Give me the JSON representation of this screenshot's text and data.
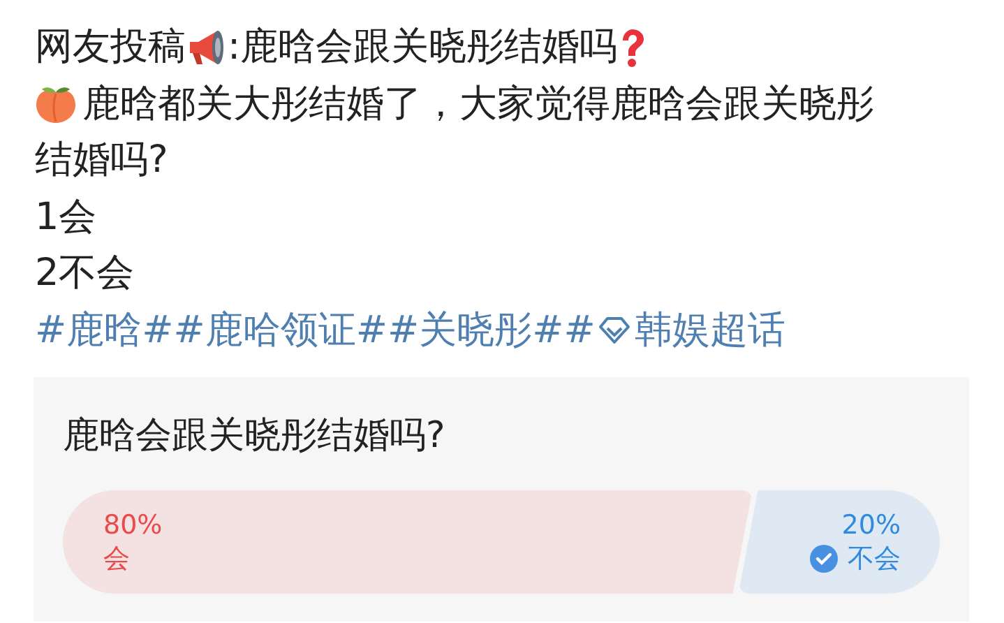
{
  "post": {
    "title": {
      "before": "网友投稿",
      "after": ":鹿晗会跟关晓彤结婚吗"
    },
    "body_lines": [
      "鹿晗都关大彤结婚了，大家觉得鹿晗会跟关晓彤",
      "结婚吗?"
    ],
    "choices": [
      "1会",
      "2不会"
    ],
    "hashtags": [
      {
        "kind": "topic",
        "text": "#鹿晗#"
      },
      {
        "kind": "topic",
        "text": "#鹿哈领证#"
      },
      {
        "kind": "topic",
        "text": "#关晓彤#"
      },
      {
        "kind": "super_topic",
        "lead": "#",
        "text": "韩娱超话"
      }
    ]
  },
  "poll": {
    "question": "鹿晗会跟关晓彤结婚吗?",
    "options": [
      {
        "percent": "80%",
        "label": "会",
        "selected": false,
        "color": "#e94a4a"
      },
      {
        "percent": "20%",
        "label": "不会",
        "selected": true,
        "color": "#2f8ae0"
      }
    ]
  }
}
